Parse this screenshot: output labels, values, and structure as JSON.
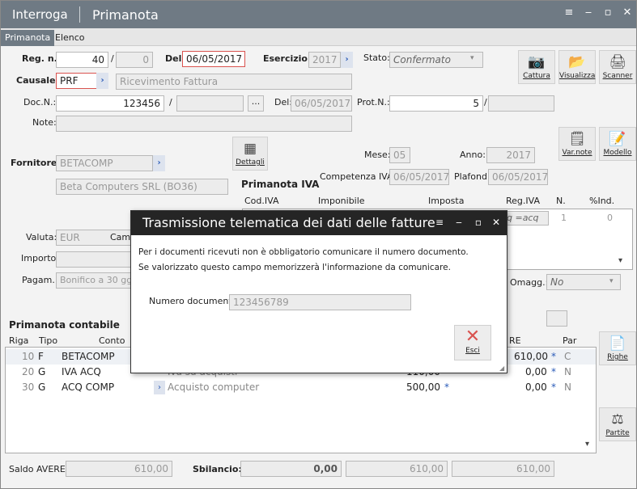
{
  "window": {
    "app": "Interroga",
    "title": "Primanota"
  },
  "tabs": [
    "Primanota",
    "Elenco"
  ],
  "form": {
    "reg_label": "Reg. n.:",
    "reg_num": "40",
    "reg_slash": "/",
    "reg_sub": "0",
    "del_label": "Del:",
    "del_date": "06/05/2017",
    "esercizio_label": "Esercizio:",
    "esercizio": "2017",
    "stato_label": "Stato:",
    "stato": "Confermato",
    "causale_label": "Causale:",
    "causale": "PRF",
    "causale_desc": "Ricevimento Fattura",
    "doc_label": "Doc.N.:",
    "doc_num": "123456",
    "doc_slash": "/",
    "doc_dots": "...",
    "doc_del_label": "Del:",
    "doc_del": "06/05/2017",
    "prot_label": "Prot.N.:",
    "prot_num": "5",
    "prot_slash": "/",
    "note_label": "Note:",
    "fornitore_label": "Fornitore:",
    "fornitore": "BETACOMP",
    "fornitore_desc": "Beta Computers SRL (BO36)",
    "dettagli": "Dettagli",
    "mese_label": "Mese:",
    "mese": "05",
    "anno_label": "Anno:",
    "anno": "2017",
    "primanota_iva": "Primanota IVA",
    "competenza_label": "Competenza IVA:",
    "competenza": "06/05/2017",
    "plafond_label": "Plafond:",
    "plafond": "06/05/2017",
    "valuta_label": "Valuta:",
    "valuta": "EUR",
    "cambio_label": "Camb",
    "importo_label": "Importo:",
    "pagam_label": "Pagam.:",
    "pagam": "Bonifico a 30 gg",
    "omagg_label": "Omagg.:",
    "omagg": "No",
    "primanota_contabile": "Primanota contabile",
    "saldo_label": "Saldo AVERE:",
    "saldo": "610,00",
    "sbilancio_label": "Sbilancio:",
    "sbilancio": "0,00",
    "tot1": "610,00",
    "tot2": "610,00"
  },
  "toolbar": {
    "cattura": "Cattura",
    "visualizza": "Visualizza",
    "scanner": "Scanner",
    "var_note": "Var.note",
    "modello": "Modello",
    "righe": "Righe",
    "partite": "Partite"
  },
  "iva_grid": {
    "headers": [
      "Cod.IVA",
      "Imponibile",
      "Imposta",
      "Reg.IVA",
      "N.",
      "%Ind."
    ],
    "row_regiva": "q =acq",
    "row_n": "1",
    "row_ind": "0"
  },
  "cont_grid": {
    "headers": [
      "Riga",
      "Tipo",
      "Conto",
      "RE",
      "Par"
    ],
    "rows": [
      {
        "riga": "10",
        "tipo": "F",
        "conto": "BETACOMP",
        "desc": "",
        "importo": "",
        "avere": "610,00",
        "par": "C"
      },
      {
        "riga": "20",
        "tipo": "G",
        "conto": "IVA ACQ",
        "desc": "Iva su acquisti",
        "importo": "110,00",
        "avere": "0,00",
        "par": "N"
      },
      {
        "riga": "30",
        "tipo": "G",
        "conto": "ACQ COMP",
        "desc": "Acquisto computer",
        "importo": "500,00",
        "avere": "0,00",
        "par": "N"
      }
    ]
  },
  "dialog": {
    "title": "Trasmissione telematica dei dati delle fatture",
    "line1": "Per i documenti ricevuti non è obbligatorio comunicare il numero documento.",
    "line2": "Se valorizzato questo campo memorizzerà l'informazione da comunicare.",
    "num_label": "Numero documento:",
    "num_value": "123456789",
    "esci": "Esci"
  }
}
